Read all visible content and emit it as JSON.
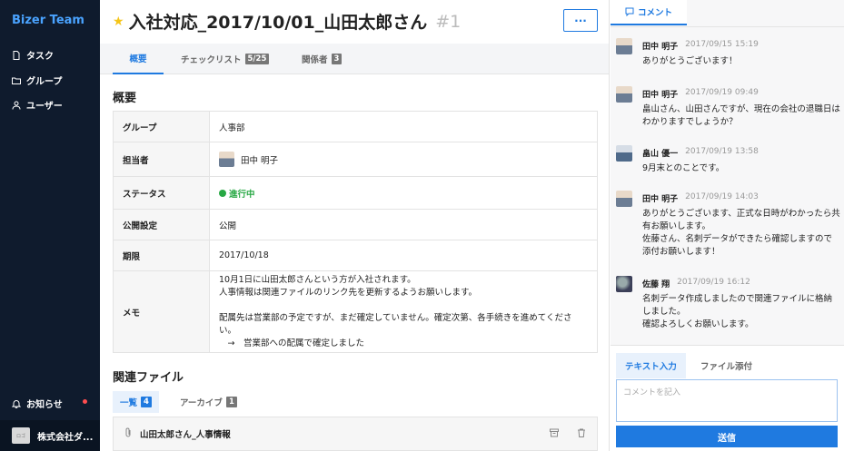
{
  "sidebar": {
    "brand": "Bizer Team",
    "items": [
      {
        "label": "タスク",
        "icon": "document-icon"
      },
      {
        "label": "グループ",
        "icon": "folder-icon"
      },
      {
        "label": "ユーザー",
        "icon": "user-icon"
      }
    ],
    "notice": {
      "label": "お知らせ",
      "icon": "bell-icon",
      "dot_color": "#ff4d4f"
    },
    "company": {
      "logo_text": "ロゴ",
      "name": "株式会社ダ..."
    }
  },
  "task": {
    "title": "入社対応_2017/10/01_山田太郎さん",
    "id": "#1",
    "more_label": "···",
    "tabs": [
      {
        "label": "概要"
      },
      {
        "label": "チェックリスト",
        "count": "5/25"
      },
      {
        "label": "関係者",
        "count": "3"
      }
    ]
  },
  "overview": {
    "heading": "概要",
    "rows": {
      "group": {
        "key": "グループ",
        "value": "人事部"
      },
      "assignee": {
        "key": "担当者",
        "value": "田中 明子"
      },
      "status": {
        "key": "ステータス",
        "value": "進行中",
        "color": "#27a844"
      },
      "visibility": {
        "key": "公開設定",
        "value": "公開"
      },
      "due": {
        "key": "期限",
        "value": "2017/10/18"
      },
      "memo": {
        "key": "メモ",
        "lines": [
          "10月1日に山田太郎さんという方が入社されます。",
          "人事情報は関連ファイルのリンク先を更新するようお願いします。",
          "",
          "配属先は営業部の予定ですが、まだ確定していません。確定次第、各手続きを進めてください。",
          "　→　営業部への配属で確定しました"
        ]
      }
    }
  },
  "files": {
    "heading": "関連ファイル",
    "tabs": [
      {
        "label": "一覧",
        "count": "4"
      },
      {
        "label": "アーカイブ",
        "count": "1"
      }
    ],
    "items": [
      {
        "name": "山田太郎さん_人事情報"
      }
    ]
  },
  "comments": {
    "tab_label": "コメント",
    "items": [
      {
        "name": "田中 明子",
        "time": "2017/09/15 15:19",
        "text": "ありがとうございます！"
      },
      {
        "name": "田中 明子",
        "time": "2017/09/19 09:49",
        "text": "畠山さん、山田さんですが、現在の会社の退職日はわかりますでしょうか？"
      },
      {
        "name": "畠山 優一",
        "time": "2017/09/19 13:58",
        "text": "9月末とのことです。"
      },
      {
        "name": "田中 明子",
        "time": "2017/09/19 14:03",
        "text": "ありがとうございます、正式な日時がわかったら共有お願いします。\n佐藤さん、名刺データができたら確認しますので添付お願いします！"
      },
      {
        "name": "佐藤 翔",
        "time": "2017/09/19 16:12",
        "text": "名刺データ作成しましたので関連ファイルに格納しました。\n確認よろしくお願いします。"
      }
    ],
    "input_tabs": [
      {
        "label": "テキスト入力"
      },
      {
        "label": "ファイル添付"
      }
    ],
    "placeholder": "コメントを記入",
    "send_label": "送信"
  }
}
